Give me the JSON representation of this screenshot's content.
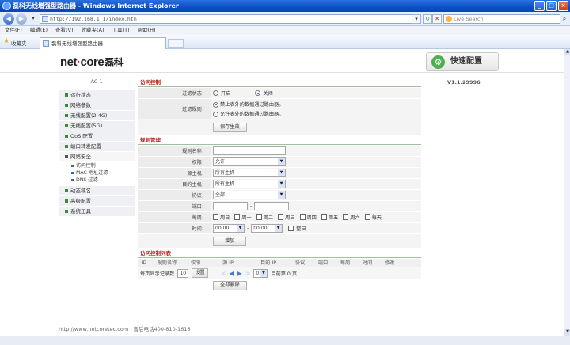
{
  "window": {
    "title": "磊科无线增强型路由器 - Windows Internet Explorer"
  },
  "addressbar": {
    "url": "http://192.168.1.1/index.htm",
    "search_placeholder": "Live Search"
  },
  "menubar": [
    "文件(F)",
    "编辑(E)",
    "查看(V)",
    "收藏夹(A)",
    "工具(T)",
    "帮助(H)"
  ],
  "favorites": {
    "label": "收藏夹"
  },
  "tab": {
    "title": "磊科无线增强型路由器"
  },
  "header": {
    "logo_main": "net",
    "logo_dot": "·",
    "logo_rest": "core",
    "logo_cn": "磊科",
    "quick_label": "快速配置"
  },
  "sidebar": {
    "model": "AC 1",
    "items": [
      {
        "label": "运行状态"
      },
      {
        "label": "网络参数"
      },
      {
        "label": "无线配置(2.4G)"
      },
      {
        "label": "无线配置(5G)"
      },
      {
        "label": "QoS 配置"
      },
      {
        "label": "端口转发配置"
      },
      {
        "label": "网络安全"
      }
    ],
    "sub_items": [
      {
        "label": "访问控制"
      },
      {
        "label": "MAC 地址过滤"
      },
      {
        "label": "DNS 过滤"
      }
    ],
    "items_after": [
      {
        "label": "动态域名"
      },
      {
        "label": "高级配置"
      },
      {
        "label": "系统工具"
      }
    ]
  },
  "version": "V1.1.29996",
  "access": {
    "title": "访问控制",
    "status_label": "过滤状态：",
    "status_on": "开启",
    "status_off": "关闭",
    "rule_label": "过滤规则：",
    "rule_deny": "禁止表外的数据通过路由器。",
    "rule_allow": "允许表外的数据通过路由器。",
    "save": "保存生效"
  },
  "rules": {
    "title": "规则管理",
    "name_label": "规则名称：",
    "perm_label": "权限：",
    "perm_value": "允许",
    "src_label": "源主机：",
    "src_value": "所有主机",
    "dst_label": "目的主机：",
    "dst_value": "所有主机",
    "proto_label": "协议：",
    "proto_value": "全部",
    "port_label": "端口：",
    "port_sep": "-",
    "week_label": "每周：",
    "days": [
      "周日",
      "周一",
      "周二",
      "周三",
      "周四",
      "周五",
      "周六",
      "每天"
    ],
    "time_label": "时间：",
    "time_start": "00:00",
    "time_sep": "-",
    "time_end": "00:00",
    "allday": "整日",
    "add": "增加"
  },
  "list": {
    "title": "访问控制列表",
    "columns": [
      "ID",
      "规则名称",
      "权限",
      "源 IP",
      "目的 IP",
      "协议",
      "端口",
      "每周",
      "时间",
      "修改"
    ],
    "per_page_label": "每页显示记录数",
    "per_page_value": "10",
    "set_label": "设置",
    "page_select": "0",
    "page_info": "目前第 0 页",
    "delete_all": "全部删除"
  },
  "footer": {
    "text": "http://www.netcoretec.com | 售后电话400-810-1616"
  }
}
